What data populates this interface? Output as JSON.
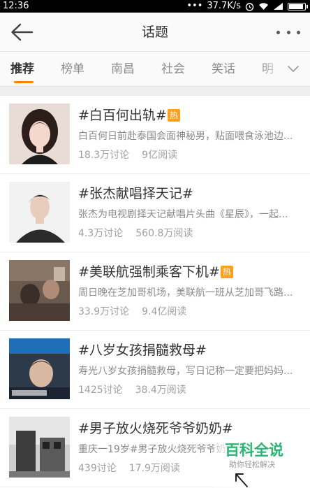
{
  "status_bar": {
    "time": "12:36",
    "dots": "•••",
    "speed": "37.7K/s"
  },
  "nav": {
    "title": "话题",
    "back_icon": "arrow-left-icon",
    "more_icon": "more-dots-icon"
  },
  "tabs": [
    {
      "label": "推荐",
      "active": true
    },
    {
      "label": "榜单",
      "active": false
    },
    {
      "label": "南昌",
      "active": false
    },
    {
      "label": "社会",
      "active": false
    },
    {
      "label": "笑话",
      "active": false
    },
    {
      "label": "明",
      "active": false
    }
  ],
  "colors": {
    "accent": "#ff8200",
    "hot_badge": "#ff9f1a",
    "watermark_green": "#2bb673"
  },
  "topics": [
    {
      "title": "#白百何出轨#",
      "hot": "热",
      "desc": "白百何日前赴泰国会面神秘男，贴面喂食泳池边...",
      "discussions": "18.3万讨论",
      "reads": "9亿阅读"
    },
    {
      "title": "#张杰献唱择天记#",
      "hot": "",
      "desc": "张杰为电视剧择天记献唱片头曲《星辰》，一起...",
      "discussions": "4.3万讨论",
      "reads": "560.8万阅读"
    },
    {
      "title": "#美联航强制乘客下机#",
      "hot": "热",
      "desc": "周日晚在芝加哥机场，美联航一班从芝加哥飞路...",
      "discussions": "33.9万讨论",
      "reads": "9.4亿阅读"
    },
    {
      "title": "#八岁女孩捐髓救母#",
      "hot": "",
      "desc": "寿光八岁女孩捐髓救母，写日记称一定要把妈妈...",
      "discussions": "1425讨论",
      "reads": "38.4万阅读"
    },
    {
      "title": "#男子放火烧死爷爷奶奶#",
      "hot": "",
      "desc": "重庆一19岁#男子放火烧死爷爷奶奶#",
      "discussions": "439讨论",
      "reads": "17.9万阅读"
    }
  ],
  "watermark": {
    "title": "百科全说",
    "subtitle": "助你轻松解决"
  }
}
